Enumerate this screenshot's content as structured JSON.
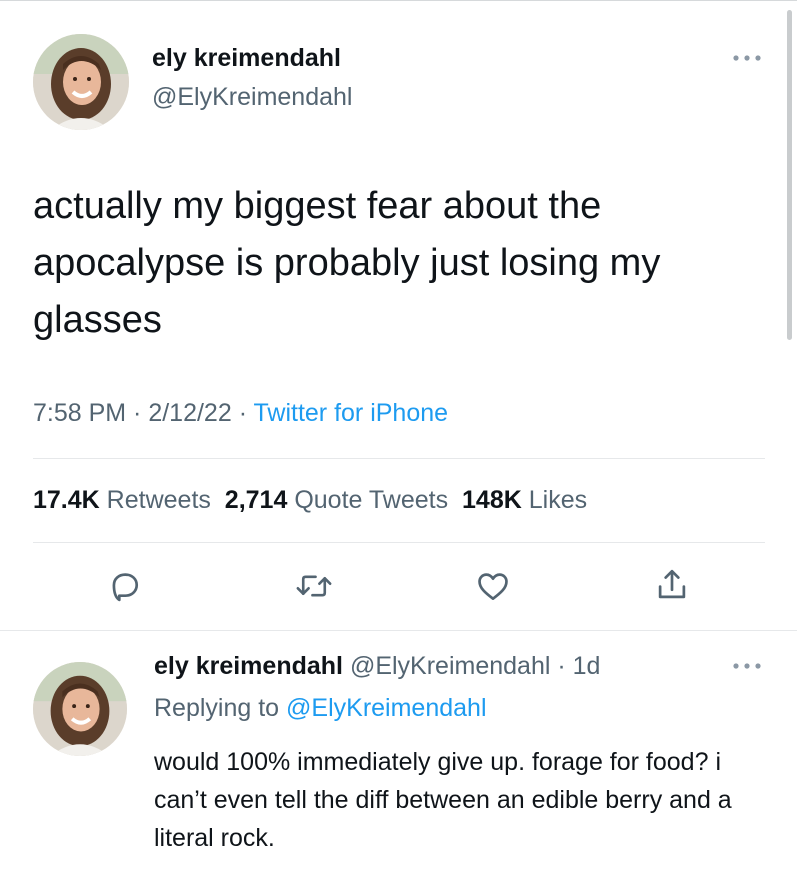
{
  "tweet": {
    "author_name": "ely kreimendahl",
    "author_handle": "@ElyKreimendahl",
    "more_icon": "more-horizontal-icon",
    "text": "actually my biggest fear about the apocalypse is probably just losing my glasses",
    "time": "7:58 PM",
    "date": "2/12/22",
    "separator": " · ",
    "source": "Twitter for iPhone",
    "stats": {
      "retweets_count": "17.4K",
      "retweets_label": "Retweets",
      "quote_count": "2,714",
      "quote_label": "Quote Tweets",
      "likes_count": "148K",
      "likes_label": "Likes"
    },
    "actions": [
      "reply-icon",
      "retweet-icon",
      "like-icon",
      "share-icon"
    ]
  },
  "reply": {
    "author_name": "ely kreimendahl",
    "author_handle": "@ElyKreimendahl",
    "age": "1d",
    "replying_prefix": "Replying to ",
    "replying_to": "@ElyKreimendahl",
    "text": "would 100% immediately give up. forage for food? i can’t even tell the diff between an edible berry and a literal rock."
  },
  "colors": {
    "text": "#0f1419",
    "secondary": "#536471",
    "accent": "#1d9bf0",
    "divider": "#e6e8ea"
  }
}
